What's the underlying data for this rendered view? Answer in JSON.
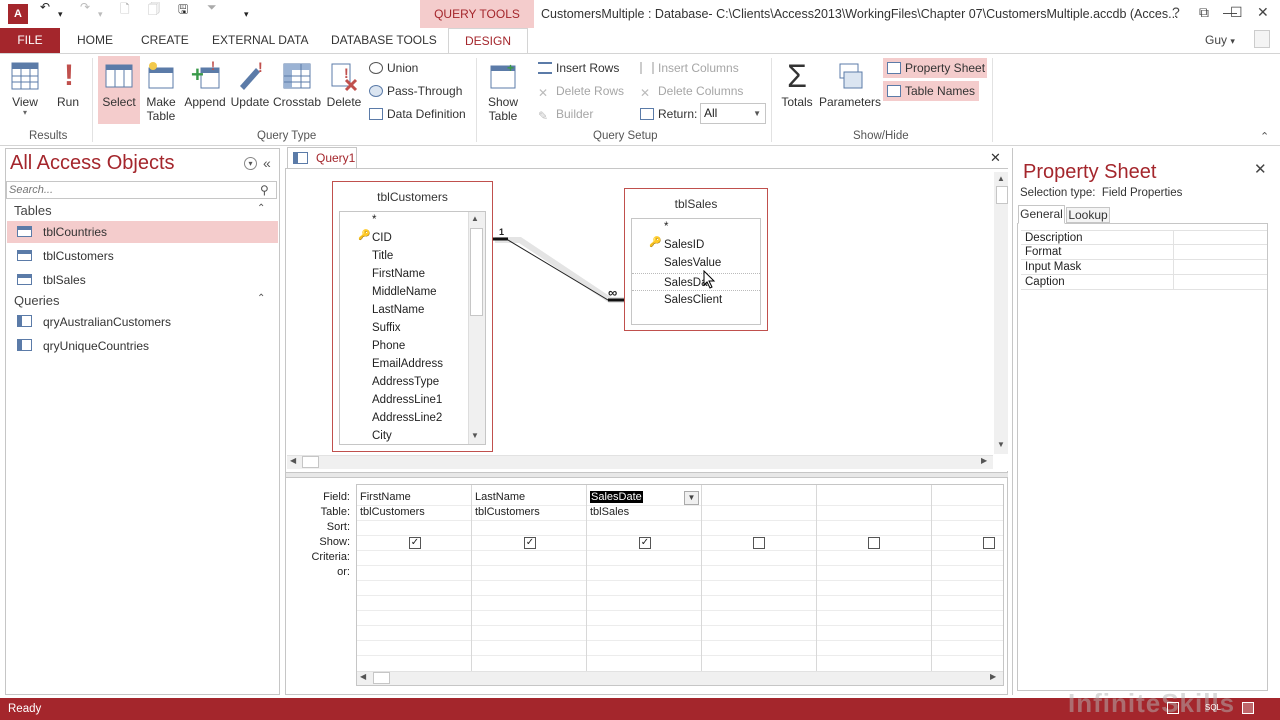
{
  "titlebar": {
    "app_icon": "A",
    "context_tab": "QUERY TOOLS",
    "title": "CustomersMultiple : Database- C:\\Clients\\Access2013\\WorkingFiles\\Chapter 07\\CustomersMultiple.accdb (Acces...",
    "help": "?",
    "restore": "⧉",
    "minimize": "—",
    "maximize": "☐",
    "close": "✕"
  },
  "tabs": {
    "file": "FILE",
    "home": "HOME",
    "create": "CREATE",
    "external": "EXTERNAL DATA",
    "dbtools": "DATABASE TOOLS",
    "design": "DESIGN",
    "user": "Guy"
  },
  "ribbon": {
    "results": {
      "label": "Results",
      "view": "View",
      "run": "Run"
    },
    "querytype": {
      "label": "Query Type",
      "select": "Select",
      "maketable_1": "Make",
      "maketable_2": "Table",
      "append": "Append",
      "update": "Update",
      "crosstab": "Crosstab",
      "delete": "Delete",
      "union": "Union",
      "passthrough": "Pass-Through",
      "datadef": "Data Definition"
    },
    "setup": {
      "label": "Query Setup",
      "showtable_1": "Show",
      "showtable_2": "Table",
      "insertrows": "Insert Rows",
      "deleterows": "Delete Rows",
      "builder": "Builder",
      "insertcols": "Insert Columns",
      "deletecols": "Delete Columns",
      "return_label": "Return:",
      "return_value": "All"
    },
    "showhide": {
      "label": "Show/Hide",
      "totals": "Totals",
      "parameters": "Parameters",
      "propsheet": "Property Sheet",
      "tablenames": "Table Names"
    }
  },
  "nav": {
    "title": "All Access Objects",
    "search_placeholder": "Search...",
    "tables_header": "Tables",
    "tables": [
      "tblCountries",
      "tblCustomers",
      "tblSales"
    ],
    "queries_header": "Queries",
    "queries": [
      "qryAustralianCustomers",
      "qryUniqueCountries"
    ]
  },
  "query": {
    "tab": "Query1",
    "close": "✕",
    "tblCustomers": {
      "title": "tblCustomers",
      "fields": [
        "*",
        "CID",
        "Title",
        "FirstName",
        "MiddleName",
        "LastName",
        "Suffix",
        "Phone",
        "EmailAddress",
        "AddressType",
        "AddressLine1",
        "AddressLine2",
        "City"
      ]
    },
    "tblSales": {
      "title": "tblSales",
      "fields": [
        "*",
        "SalesID",
        "SalesValue",
        "SalesDa",
        "SalesClient"
      ]
    },
    "join": {
      "one": "1",
      "many": "∞"
    }
  },
  "grid": {
    "labels": {
      "field": "Field:",
      "table": "Table:",
      "sort": "Sort:",
      "show": "Show:",
      "criteria": "Criteria:",
      "or": "or:"
    },
    "columns": [
      {
        "field": "FirstName",
        "table": "tblCustomers"
      },
      {
        "field": "LastName",
        "table": "tblCustomers"
      },
      {
        "field": "SalesDate",
        "table": "tblSales"
      }
    ]
  },
  "propsheet": {
    "title": "Property Sheet",
    "selection": "Selection type:  Field Properties",
    "tab_general": "General",
    "tab_lookup": "Lookup",
    "rows": [
      "Description",
      "Format",
      "Input Mask",
      "Caption"
    ]
  },
  "status": {
    "text": "Ready"
  },
  "watermark": "InfiniteSkills"
}
